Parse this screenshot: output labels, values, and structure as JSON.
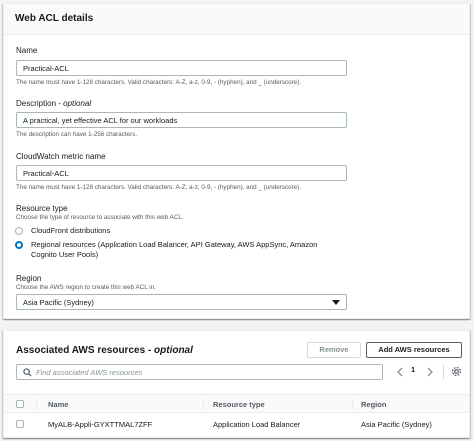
{
  "web_acl": {
    "title": "Web ACL details",
    "name_label": "Name",
    "name_value": "Practical-ACL",
    "name_hint": "The name must have 1-128 characters. Valid characters: A-Z, a-z, 0-9, - (hyphen), and _ (underscore).",
    "description_label": "Description - ",
    "description_optional": "optional",
    "description_value": "A practical, yet effective ACL for our workloads",
    "description_hint": "The description can have 1-256 characters.",
    "metric_label": "CloudWatch metric name",
    "metric_value": "Practical-ACL",
    "metric_hint": "The name must have 1-128 characters. Valid characters: A-Z, a-z, 0-9, - (hyphen), and _ (underscore).",
    "resource_type_label": "Resource type",
    "resource_type_hint": "Choose the type of resource to associate with this web ACL.",
    "resource_options": [
      {
        "label": "CloudFront distributions",
        "checked": false
      },
      {
        "label": "Regional resources (Application Load Balancer, API Gateway, AWS AppSync, Amazon",
        "label2": "Cognito User Pools)",
        "checked": true
      }
    ],
    "region_label": "Region",
    "region_hint": "Choose the AWS region to create this web ACL in.",
    "region_value": "Asia Pacific (Sydney)"
  },
  "associated": {
    "title": "Associated AWS resources - ",
    "title_optional": "optional",
    "remove_label": "Remove",
    "add_label": "Add AWS resources",
    "search_placeholder": "Find associated AWS resources",
    "page_number": "1",
    "columns": [
      "Name",
      "Resource type",
      "Region"
    ],
    "rows": [
      {
        "name": "MyALB-Appli-GYXTTMAL7ZFF",
        "type": "Application Load Balancer",
        "region": "Asia Pacific (Sydney)"
      }
    ]
  }
}
